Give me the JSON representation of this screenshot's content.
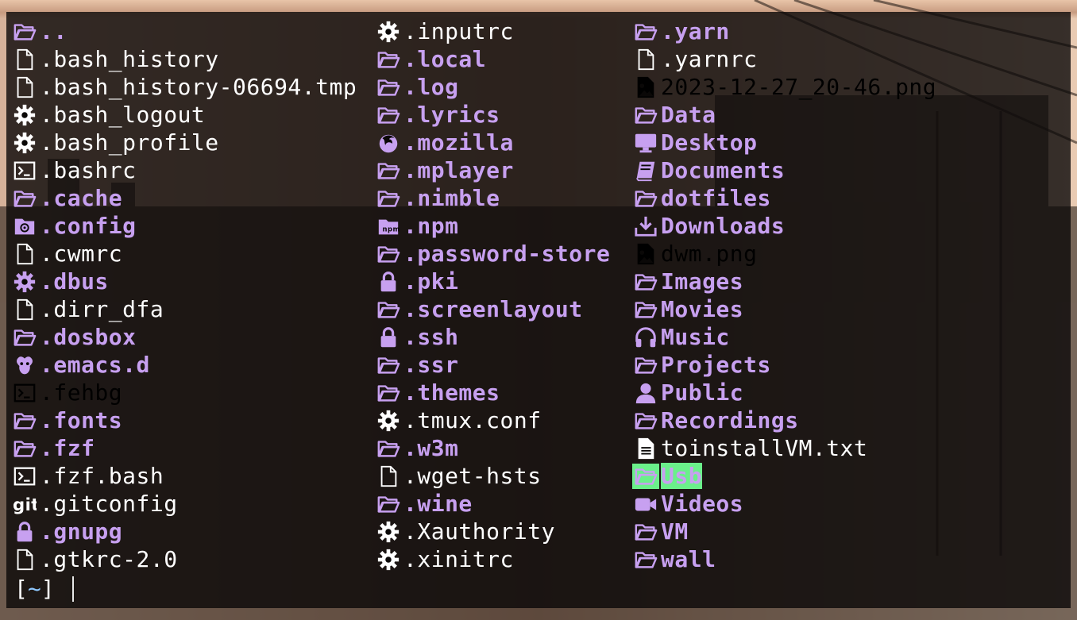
{
  "colors": {
    "dir": "#c7a0f0",
    "file": "#ffffff",
    "image": "#ff79b8",
    "exec": "#6af08a"
  },
  "columns": [
    [
      {
        "name": "..",
        "kind": "dir",
        "icon": "folder-open"
      },
      {
        "name": ".bash_history",
        "kind": "file",
        "icon": "file"
      },
      {
        "name": ".bash_history-06694.tmp",
        "kind": "file",
        "icon": "file"
      },
      {
        "name": ".bash_logout",
        "kind": "file",
        "icon": "gear"
      },
      {
        "name": ".bash_profile",
        "kind": "file",
        "icon": "gear"
      },
      {
        "name": ".bashrc",
        "kind": "file",
        "icon": "terminal"
      },
      {
        "name": ".cache",
        "kind": "dir",
        "icon": "folder-open"
      },
      {
        "name": ".config",
        "kind": "dir",
        "icon": "folder-config"
      },
      {
        "name": ".cwmrc",
        "kind": "file",
        "icon": "file"
      },
      {
        "name": ".dbus",
        "kind": "dir",
        "icon": "gear"
      },
      {
        "name": ".dirr_dfa",
        "kind": "file",
        "icon": "file"
      },
      {
        "name": ".dosbox",
        "kind": "dir",
        "icon": "folder-open"
      },
      {
        "name": ".emacs.d",
        "kind": "dir",
        "icon": "emacs"
      },
      {
        "name": ".fehbg",
        "kind": "exec",
        "icon": "terminal"
      },
      {
        "name": ".fonts",
        "kind": "dir",
        "icon": "folder-open"
      },
      {
        "name": ".fzf",
        "kind": "dir",
        "icon": "folder-open"
      },
      {
        "name": ".fzf.bash",
        "kind": "file",
        "icon": "terminal"
      },
      {
        "name": ".gitconfig",
        "kind": "file",
        "icon": "git"
      },
      {
        "name": ".gnupg",
        "kind": "dir",
        "icon": "lock"
      },
      {
        "name": ".gtkrc-2.0",
        "kind": "file",
        "icon": "file"
      }
    ],
    [
      {
        "name": ".inputrc",
        "kind": "file",
        "icon": "gear"
      },
      {
        "name": ".local",
        "kind": "dir",
        "icon": "folder-open"
      },
      {
        "name": ".log",
        "kind": "dir",
        "icon": "folder-open"
      },
      {
        "name": ".lyrics",
        "kind": "dir",
        "icon": "folder-open"
      },
      {
        "name": ".mozilla",
        "kind": "dir",
        "icon": "firefox"
      },
      {
        "name": ".mplayer",
        "kind": "dir",
        "icon": "folder-open"
      },
      {
        "name": ".nimble",
        "kind": "dir",
        "icon": "folder-open"
      },
      {
        "name": ".npm",
        "kind": "dir",
        "icon": "npm"
      },
      {
        "name": ".password-store",
        "kind": "dir",
        "icon": "folder-open"
      },
      {
        "name": ".pki",
        "kind": "dir",
        "icon": "lock"
      },
      {
        "name": ".screenlayout",
        "kind": "dir",
        "icon": "folder-open"
      },
      {
        "name": ".ssh",
        "kind": "dir",
        "icon": "lock"
      },
      {
        "name": ".ssr",
        "kind": "dir",
        "icon": "folder-open"
      },
      {
        "name": ".themes",
        "kind": "dir",
        "icon": "folder-open"
      },
      {
        "name": ".tmux.conf",
        "kind": "file",
        "icon": "gear"
      },
      {
        "name": ".w3m",
        "kind": "dir",
        "icon": "folder-open"
      },
      {
        "name": ".wget-hsts",
        "kind": "file",
        "icon": "file"
      },
      {
        "name": ".wine",
        "kind": "dir",
        "icon": "folder-open"
      },
      {
        "name": ".Xauthority",
        "kind": "file",
        "icon": "gear"
      },
      {
        "name": ".xinitrc",
        "kind": "file",
        "icon": "gear"
      }
    ],
    [
      {
        "name": ".yarn",
        "kind": "dir",
        "icon": "folder-open"
      },
      {
        "name": ".yarnrc",
        "kind": "file",
        "icon": "file"
      },
      {
        "name": "2023-12-27_20-46.png",
        "kind": "image",
        "icon": "image"
      },
      {
        "name": "Data",
        "kind": "dir",
        "icon": "folder-open"
      },
      {
        "name": "Desktop",
        "kind": "dir",
        "icon": "desktop"
      },
      {
        "name": "Documents",
        "kind": "dir",
        "icon": "book"
      },
      {
        "name": "dotfiles",
        "kind": "dir",
        "icon": "folder-open"
      },
      {
        "name": "Downloads",
        "kind": "dir",
        "icon": "download"
      },
      {
        "name": "dwm.png",
        "kind": "image",
        "icon": "image"
      },
      {
        "name": "Images",
        "kind": "dir",
        "icon": "folder-open"
      },
      {
        "name": "Movies",
        "kind": "dir",
        "icon": "folder-open"
      },
      {
        "name": "Music",
        "kind": "dir",
        "icon": "headphones"
      },
      {
        "name": "Projects",
        "kind": "dir",
        "icon": "folder-open"
      },
      {
        "name": "Public",
        "kind": "dir",
        "icon": "user"
      },
      {
        "name": "Recordings",
        "kind": "dir",
        "icon": "folder-open"
      },
      {
        "name": "toinstallVM.txt",
        "kind": "file",
        "icon": "file-text"
      },
      {
        "name": "Usb",
        "kind": "highlight",
        "icon": "folder-open"
      },
      {
        "name": "Videos",
        "kind": "dir",
        "icon": "video"
      },
      {
        "name": "VM",
        "kind": "dir",
        "icon": "folder-open"
      },
      {
        "name": "wall",
        "kind": "dir",
        "icon": "folder-open"
      }
    ]
  ],
  "prompt": {
    "open": "[",
    "path": "~",
    "close": "]"
  }
}
